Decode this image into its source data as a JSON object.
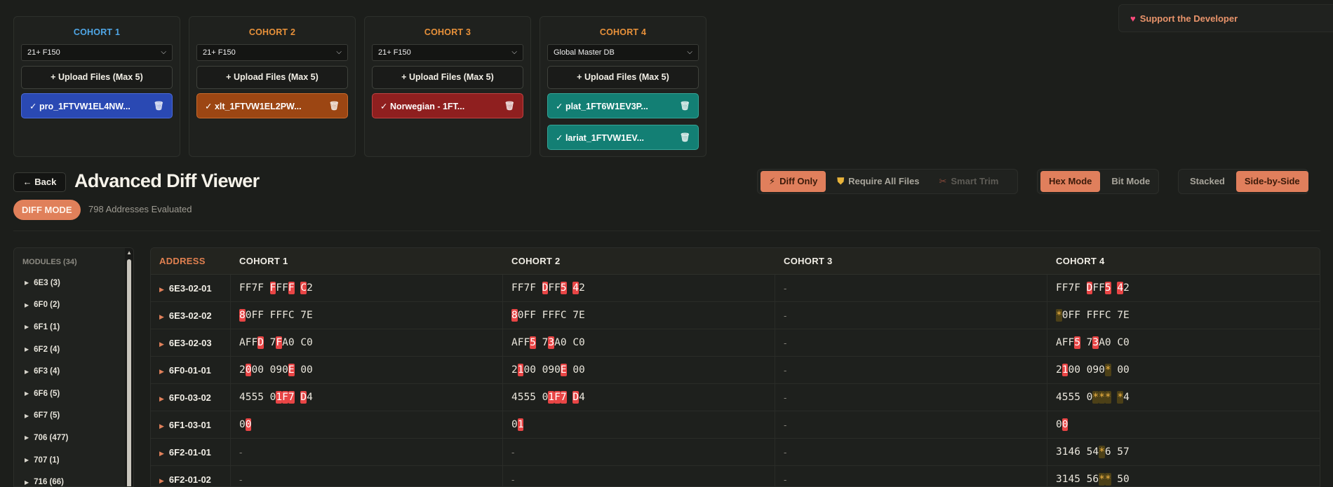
{
  "cohorts": [
    {
      "title": "COHORT 1",
      "color": "#4fa6e6",
      "select": "21+ F150",
      "upload": "+ Upload Files (Max 5)",
      "files": [
        {
          "name": "✓ pro_1FTVW1EL4NW...",
          "style": "f-blue"
        }
      ]
    },
    {
      "title": "COHORT 2",
      "color": "#e8913a",
      "select": "21+ F150",
      "upload": "+ Upload Files (Max 5)",
      "files": [
        {
          "name": "✓ xlt_1FTVW1EL2PW...",
          "style": "f-orange"
        }
      ]
    },
    {
      "title": "COHORT 3",
      "color": "#e8913a",
      "select": "21+ F150",
      "upload": "+ Upload Files (Max 5)",
      "files": [
        {
          "name": "✓ Norwegian - 1FT...",
          "style": "f-red"
        }
      ]
    },
    {
      "title": "COHORT 4",
      "color": "#e8913a",
      "select": "Global Master DB",
      "upload": "+ Upload Files (Max 5)",
      "files": [
        {
          "name": "✓ plat_1FT6W1EV3P...",
          "style": "f-teal"
        },
        {
          "name": "✓ lariat_1FTVW1EV...",
          "style": "f-teal"
        }
      ]
    }
  ],
  "support": {
    "label": "Support the Developer",
    "icon": "heart-icon"
  },
  "header": {
    "back_label": "← Back",
    "title": "Advanced Diff Viewer",
    "mode_badge": "DIFF MODE",
    "address_count": "798 Addresses Evaluated"
  },
  "filters": {
    "diff_only": "Diff Only",
    "require_all": "Require All Files",
    "smart_trim": "Smart Trim"
  },
  "modes": {
    "hex": "Hex Mode",
    "bit": "Bit Mode",
    "active": "hex"
  },
  "layout_modes": {
    "stacked": "Stacked",
    "side_by_side": "Side-by-Side",
    "active": "side_by_side"
  },
  "sidebar": {
    "heading": "MODULES (34)",
    "modules": [
      "6E3 (3)",
      "6F0 (2)",
      "6F1 (1)",
      "6F2 (4)",
      "6F3 (4)",
      "6F6 (5)",
      "6F7 (5)",
      "706 (477)",
      "707 (1)",
      "716 (66)"
    ]
  },
  "table": {
    "headers": [
      "ADDRESS",
      "COHORT 1",
      "COHORT 2",
      "COHORT 3",
      "COHORT 4"
    ],
    "rows": [
      {
        "address": "6E3-02-01",
        "cells": [
          "FF7F [F]FF[F] [C]2",
          "FF7F [D]FF[5] [4]2",
          "-",
          "FF7F [D]FF[5] [4]2"
        ]
      },
      {
        "address": "6E3-02-02",
        "cells": [
          "[8]0FF FFFC 7E",
          "[8]0FF FFFC 7E",
          "-",
          "{*}0FF FFFC 7E"
        ]
      },
      {
        "address": "6E3-02-03",
        "cells": [
          "AFF[D] 7[F]A0 C0",
          "AFF[5] 7[3]A0 C0",
          "-",
          "AFF[5] 7[3]A0 C0"
        ]
      },
      {
        "address": "6F0-01-01",
        "cells": [
          "2[0]00 090[E] 00",
          "2[1]00 090[E] 00",
          "-",
          "2[1]00 090{*} 00"
        ]
      },
      {
        "address": "6F0-03-02",
        "cells": [
          "4555 0[1][F][7] [D]4",
          "4555 0[1][F][7] [D]4",
          "-",
          "4555 0{*}{*}{*} {*}4"
        ]
      },
      {
        "address": "6F1-03-01",
        "cells": [
          "0[0]",
          "0[1]",
          "-",
          "0[0]"
        ]
      },
      {
        "address": "6F2-01-01",
        "cells": [
          "-",
          "-",
          "-",
          "3146 54{*}6 57"
        ]
      },
      {
        "address": "6F2-01-02",
        "cells": [
          "-",
          "-",
          "-",
          "3145 56{*}{*} 50"
        ]
      }
    ]
  }
}
